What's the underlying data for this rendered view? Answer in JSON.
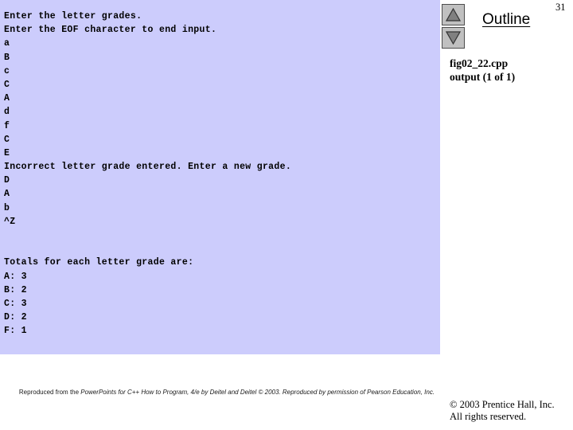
{
  "slide": {
    "page_number": "31",
    "background_color": "#ffffff"
  },
  "console": {
    "background_color": "#ccccfc",
    "text_color": "#000000",
    "lines": [
      "Enter the letter grades.",
      "Enter the EOF character to end input.",
      "a",
      "B",
      "c",
      "C",
      "A",
      "d",
      "f",
      "C",
      "E",
      "Incorrect letter grade entered. Enter a new grade.",
      "D",
      "A",
      "b",
      "^Z",
      "",
      "",
      "Totals for each letter grade are:",
      "A: 3",
      "B: 2",
      "C: 3",
      "D: 2",
      "F: 1"
    ]
  },
  "outline": {
    "title": "Outline",
    "nav_up_icon": "triangle-up-icon",
    "nav_down_icon": "triangle-down-icon",
    "button_face_color": "#c0c0c0",
    "triangle_color": "#808080",
    "file_name": "fig02_22.cpp",
    "file_part": "output (1 of 1)"
  },
  "footer": {
    "credit_prefix": "Reproduced from the ",
    "credit_italic": "PowerPoints for C++ How to Program, 4/e by Deitel and Deitel © 2003. Reproduced by permission of Pearson Education, Inc.",
    "copyright_line1": "© 2003 Prentice Hall, Inc.",
    "copyright_line2": "All rights reserved."
  }
}
